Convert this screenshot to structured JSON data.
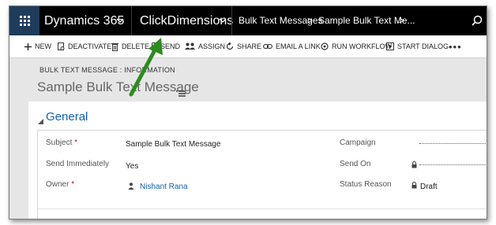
{
  "topbar": {
    "app_name": "Dynamics 365",
    "area": "ClickDimensions",
    "breadcrumb": [
      "Bulk Text Messages",
      "Sample Bulk Text Me..."
    ],
    "arrow_glyph": ">",
    "chevron_glyph": "⌄"
  },
  "commands": {
    "new": "NEW",
    "deactivate": "DEACTIVATE",
    "delete": "DELETE",
    "send": "SEND",
    "assign": "ASSIGN",
    "share": "SHARE",
    "email_link": "EMAIL A LINK",
    "run_workflow": "RUN WORKFLOW",
    "start_dialog": "START DIALOG",
    "more": "•••"
  },
  "header": {
    "entity_type": "BULK TEXT MESSAGE : INFORMATION",
    "record_name": "Sample Bulk Text Message"
  },
  "section": {
    "title": "General"
  },
  "form": {
    "left": [
      {
        "label": "Subject",
        "required": true,
        "value": "Sample Bulk Text Message"
      },
      {
        "label": "Send Immediately",
        "required": false,
        "value": "Yes"
      },
      {
        "label": "Owner",
        "required": true,
        "value": "Nishant Rana"
      }
    ],
    "right": [
      {
        "label": "Campaign",
        "value": ""
      },
      {
        "label": "Send On",
        "value": ""
      },
      {
        "label": "Status Reason",
        "value": "Draft"
      }
    ],
    "required_marker": "*"
  },
  "colors": {
    "topbar": "#000000",
    "waffle": "#1f3c5a",
    "link": "#1160b7",
    "arrow": "#2e8b1e",
    "required": "#d0021b"
  }
}
